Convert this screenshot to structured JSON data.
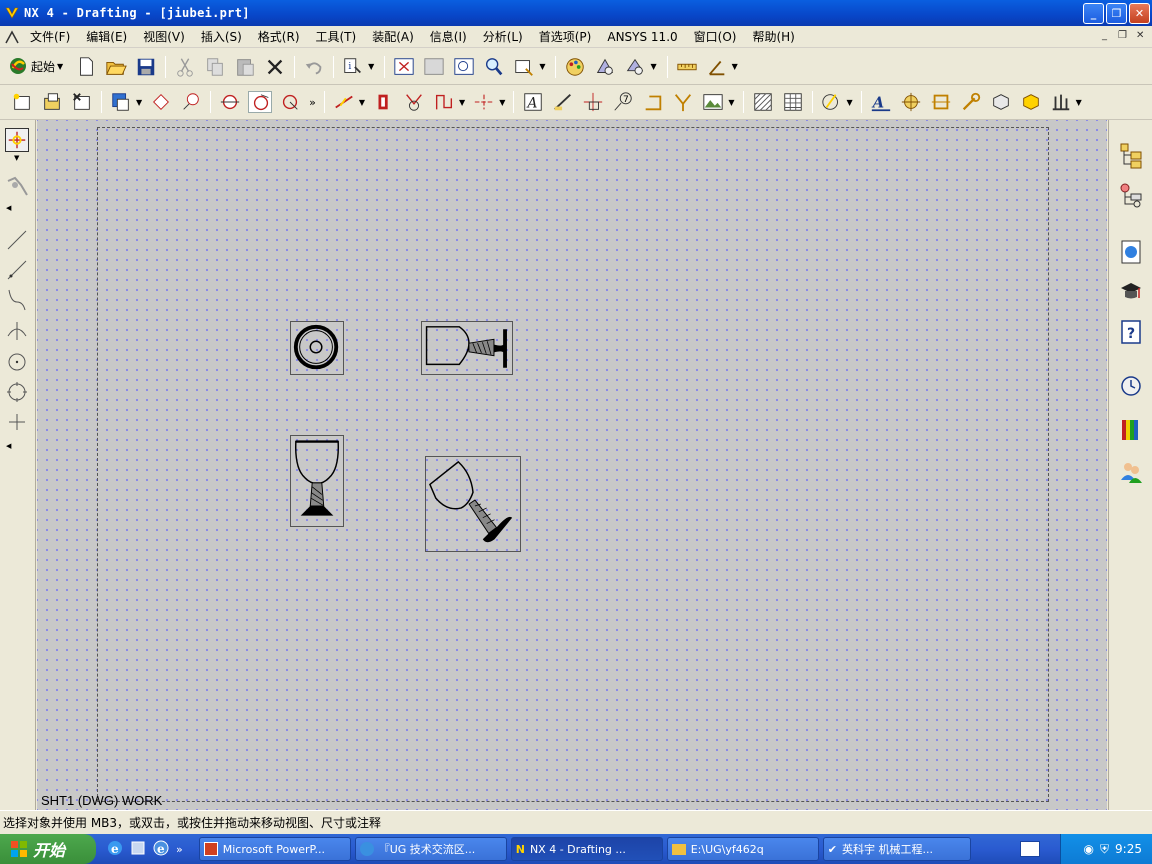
{
  "window": {
    "title": "NX 4 - Drafting - [jiubei.prt]"
  },
  "menu": {
    "items": [
      "文件(F)",
      "编辑(E)",
      "视图(V)",
      "插入(S)",
      "格式(R)",
      "工具(T)",
      "装配(A)",
      "信息(I)",
      "分析(L)",
      "首选项(P)",
      "ANSYS 11.0",
      "窗口(O)",
      "帮助(H)"
    ]
  },
  "toolbar": {
    "start_label": "起始",
    "overflow": "»"
  },
  "canvas": {
    "sheet_label": "SHT1 (DWG) WORK"
  },
  "status": {
    "text": "选择对象并使用 MB3，或双击，或按住并拖动来移动视图、尺寸或注释"
  },
  "taskbar": {
    "start_label": "开始",
    "quicklaunch_overflow": "»",
    "tasks": [
      "Microsoft PowerP...",
      "『UG 技术交流区...",
      "NX 4 - Drafting ...",
      "E:\\UG\\yf462q",
      "英科宇 机械工程..."
    ],
    "clock": "9:25"
  },
  "colors": {
    "titlebar": "#0846c8",
    "canvas": "#c8c8c8",
    "grid_dot": "#7a7af0",
    "taskbar": "#2a5bd0",
    "start": "#3a8f3a"
  }
}
